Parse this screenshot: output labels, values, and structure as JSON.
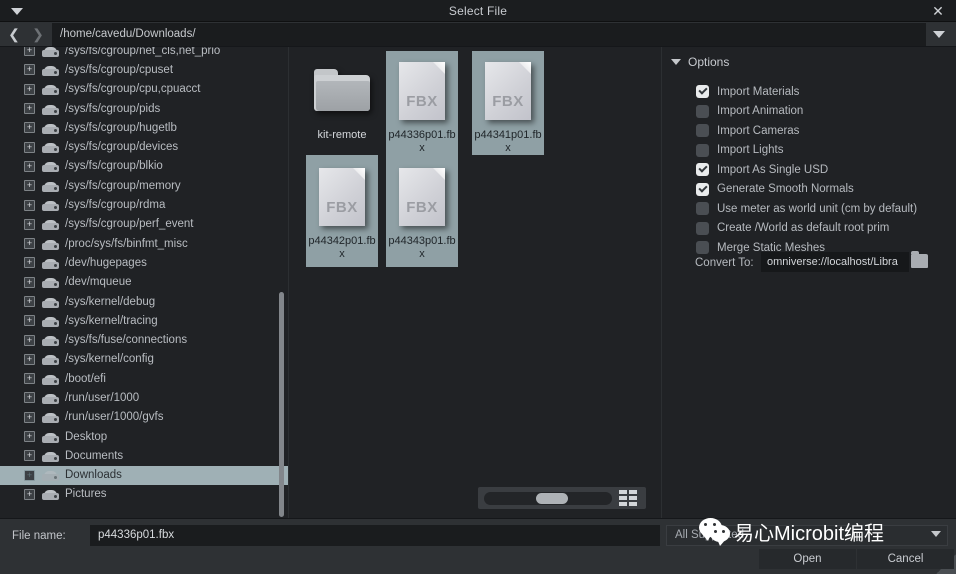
{
  "window": {
    "title": "Select File",
    "menu_caret_icon": "caret-down-icon",
    "close_icon": "close-icon"
  },
  "pathbar": {
    "back_icon": "chevron-left-icon",
    "forward_icon": "chevron-right-icon",
    "path": "/home/cavedu/Downloads/",
    "dropdown_icon": "caret-down-icon"
  },
  "tree": {
    "items": [
      {
        "label": "/sys/fs/cgroup/net_cls,net_prio",
        "selected": false
      },
      {
        "label": "/sys/fs/cgroup/cpuset",
        "selected": false
      },
      {
        "label": "/sys/fs/cgroup/cpu,cpuacct",
        "selected": false
      },
      {
        "label": "/sys/fs/cgroup/pids",
        "selected": false
      },
      {
        "label": "/sys/fs/cgroup/hugetlb",
        "selected": false
      },
      {
        "label": "/sys/fs/cgroup/devices",
        "selected": false
      },
      {
        "label": "/sys/fs/cgroup/blkio",
        "selected": false
      },
      {
        "label": "/sys/fs/cgroup/memory",
        "selected": false
      },
      {
        "label": "/sys/fs/cgroup/rdma",
        "selected": false
      },
      {
        "label": "/sys/fs/cgroup/perf_event",
        "selected": false
      },
      {
        "label": "/proc/sys/fs/binfmt_misc",
        "selected": false
      },
      {
        "label": "/dev/hugepages",
        "selected": false
      },
      {
        "label": "/dev/mqueue",
        "selected": false
      },
      {
        "label": "/sys/kernel/debug",
        "selected": false
      },
      {
        "label": "/sys/kernel/tracing",
        "selected": false
      },
      {
        "label": "/sys/fs/fuse/connections",
        "selected": false
      },
      {
        "label": "/sys/kernel/config",
        "selected": false
      },
      {
        "label": "/boot/efi",
        "selected": false
      },
      {
        "label": "/run/user/1000",
        "selected": false
      },
      {
        "label": "/run/user/1000/gvfs",
        "selected": false
      },
      {
        "label": "Desktop",
        "selected": false
      },
      {
        "label": "Documents",
        "selected": false
      },
      {
        "label": "Downloads",
        "selected": true
      },
      {
        "label": "Pictures",
        "selected": false
      }
    ],
    "expander_glyph": "+"
  },
  "files": {
    "items": [
      {
        "name": "kit-remote",
        "type": "folder",
        "selected": false
      },
      {
        "name": "p44336p01.fbx",
        "type": "fbx",
        "selected": true
      },
      {
        "name": "p44341p01.fbx",
        "type": "fbx",
        "selected": true
      },
      {
        "name": "p44342p01.fbx",
        "type": "fbx",
        "selected": true
      },
      {
        "name": "p44343p01.fbx",
        "type": "fbx",
        "selected": true
      }
    ],
    "doc_badge": "FBX",
    "zoom_slider_value": 40,
    "view_mode_icon": "grid-view-icon"
  },
  "options": {
    "header": "Options",
    "collapse_icon": "caret-down-icon",
    "checkboxes": [
      {
        "label": "Import Materials",
        "checked": true
      },
      {
        "label": "Import Animation",
        "checked": false
      },
      {
        "label": "Import Cameras",
        "checked": false
      },
      {
        "label": "Import Lights",
        "checked": false
      },
      {
        "label": "Import As Single USD",
        "checked": true
      },
      {
        "label": "Generate Smooth Normals",
        "checked": true
      },
      {
        "label": "Use meter as world unit (cm by default)",
        "checked": false
      },
      {
        "label": "Create /World as default root prim",
        "checked": false
      },
      {
        "label": "Merge Static Meshes",
        "checked": false
      }
    ],
    "convert_to_label": "Convert To:",
    "convert_to_value": "omniverse://localhost/Libra",
    "browse_icon": "folder-icon"
  },
  "bottom": {
    "file_name_label": "File name:",
    "file_name_value": "p44336p01.fbx",
    "filter_value": "All Supported",
    "filter_caret_icon": "caret-down-icon",
    "open_label": "Open",
    "cancel_label": "Cancel"
  },
  "watermark": {
    "logo_icon": "wechat-logo-icon",
    "text": "易心Microbit编程"
  },
  "colors": {
    "window_bg": "#202225",
    "titlebar_bg": "#1b1d1f",
    "pathbar_bg": "#2e3134",
    "selection": "#8fa0a5",
    "tree_selection": "#9fb0b5",
    "text": "#c2c5ca",
    "field_bg": "#1a1c1e"
  }
}
